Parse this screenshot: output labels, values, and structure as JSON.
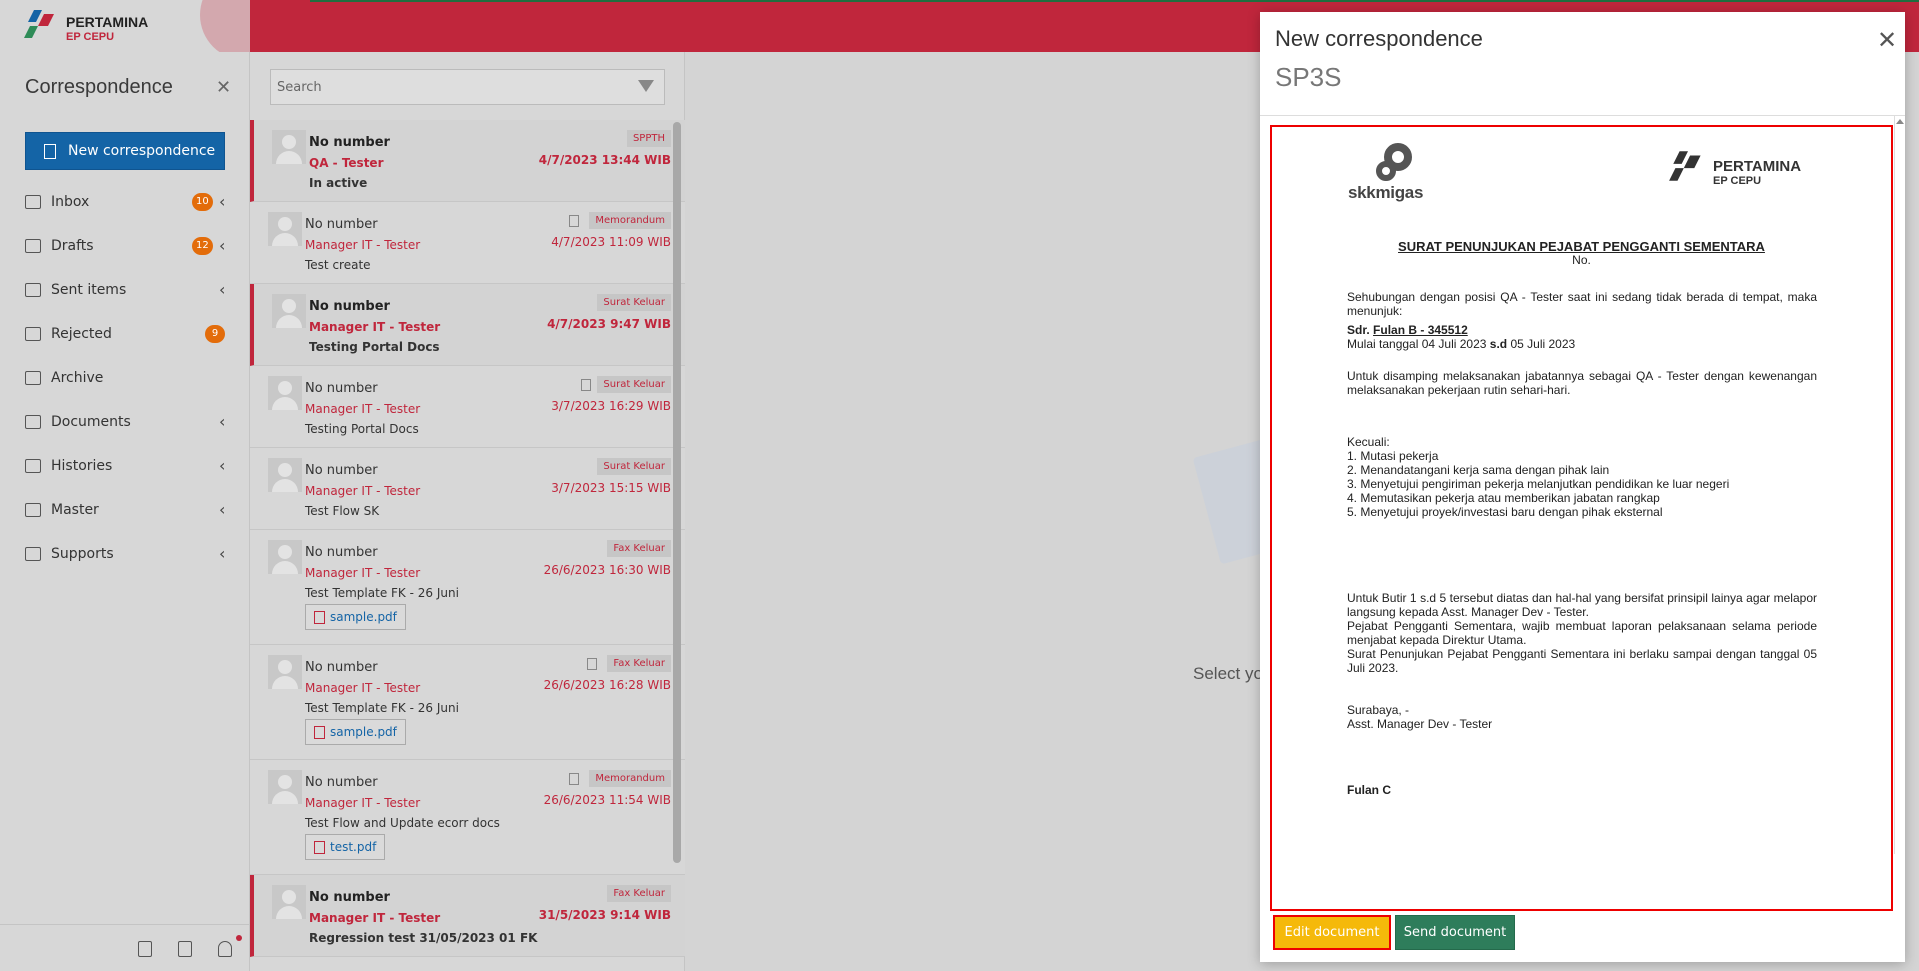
{
  "brand": {
    "name": "PERTAMINA",
    "sub": "EP CEPU"
  },
  "sidebar": {
    "title": "Correspondence",
    "new_button": "New correspondence",
    "items": [
      {
        "label": "Inbox",
        "badge": "10",
        "icon": "inbox-icon"
      },
      {
        "label": "Drafts",
        "badge": "12",
        "icon": "drafts-icon"
      },
      {
        "label": "Sent items",
        "icon": "sent-icon"
      },
      {
        "label": "Rejected",
        "badge": "9",
        "icon": "rejected-icon"
      },
      {
        "label": "Archive",
        "icon": "archive-icon"
      },
      {
        "label": "Documents",
        "icon": "documents-icon"
      },
      {
        "label": "Histories",
        "icon": "histories-icon"
      },
      {
        "label": "Master",
        "icon": "master-icon"
      },
      {
        "label": "Supports",
        "icon": "supports-icon"
      }
    ]
  },
  "search": {
    "placeholder": "Search"
  },
  "messages": [
    {
      "number": "No number",
      "sender": "QA - Tester",
      "subject": "In active",
      "tag": "SPPTH",
      "date": "4/7/2023 13:44 WIB",
      "unread": true
    },
    {
      "number": "No number",
      "sender": "Manager IT - Tester",
      "subject": "Test create",
      "tag": "Memorandum",
      "date": "4/7/2023 11:09 WIB",
      "unread": false
    },
    {
      "number": "No number",
      "sender": "Manager IT - Tester",
      "subject": "Testing Portal Docs",
      "tag": "Surat Keluar",
      "date": "4/7/2023 9:47 WIB",
      "unread": true
    },
    {
      "number": "No number",
      "sender": "Manager IT - Tester",
      "subject": "Testing Portal Docs",
      "tag": "Surat Keluar",
      "date": "3/7/2023 16:29 WIB",
      "unread": false
    },
    {
      "number": "No number",
      "sender": "Manager IT - Tester",
      "subject": "Test Flow SK",
      "tag": "Surat Keluar",
      "date": "3/7/2023 15:15 WIB",
      "unread": false
    },
    {
      "number": "No number",
      "sender": "Manager IT - Tester",
      "subject": "Test Template FK - 26 Juni",
      "tag": "Fax Keluar",
      "date": "26/6/2023 16:30 WIB",
      "attachment": "sample.pdf",
      "unread": false
    },
    {
      "number": "No number",
      "sender": "Manager IT - Tester",
      "subject": "Test Template FK - 26 Juni",
      "tag": "Fax Keluar",
      "date": "26/6/2023 16:28 WIB",
      "attachment": "sample.pdf",
      "unread": false
    },
    {
      "number": "No number",
      "sender": "Manager IT - Tester",
      "subject": "Test Flow and Update ecorr docs",
      "tag": "Memorandum",
      "date": "26/6/2023 11:54 WIB",
      "attachment": "test.pdf",
      "unread": false
    },
    {
      "number": "No number",
      "sender": "Manager IT - Tester",
      "subject": "Regression test 31/05/2023 01 FK",
      "tag": "Fax Keluar",
      "date": "31/5/2023 9:14 WIB",
      "unread": true
    }
  ],
  "center": {
    "placeholder": "Select yo"
  },
  "modal": {
    "title": "New correspondence",
    "subtitle": "SP3S",
    "document": {
      "skk_logo": "skkmigas",
      "pertamina_logo": "PERTAMINA",
      "pertamina_sub": "EP CEPU",
      "title": "SURAT PENUNJUKAN PEJABAT PENGGANTI SEMENTARA",
      "no": "No.",
      "p1": "Sehubungan dengan posisi QA - Tester saat ini sedang tidak berada di tempat, maka menunjuk:",
      "sdr_label": "Sdr.",
      "sdr_name": "Fulan B - 345512",
      "period": "Mulai tanggal 04 Juli 2023",
      "period_sd": "s.d",
      "period_end": "05 Juli 2023",
      "p2": "Untuk disamping melaksanakan jabatannya sebagai QA - Tester dengan kewenangan melaksanakan pekerjaan rutin sehari-hari.",
      "except_title": "Kecuali:",
      "except_items": [
        "1. Mutasi pekerja",
        "2. Menandatangani  kerja sama dengan pihak lain",
        "3. Menyetujui  pengiriman pekerja melanjutkan  pendidikan ke luar negeri",
        "4. Memutasikan pekerja atau memberikan jabatan rangkap",
        "5. Menyetujui  proyek/investasi  baru dengan pihak eksternal"
      ],
      "p3": "Untuk Butir 1 s.d 5 tersebut diatas dan hal-hal yang bersifat prinsipil lainya agar melapor langsung kepada Asst. Manager Dev - Tester.",
      "p4": "Pejabat Pengganti Sementara, wajib membuat laporan pelaksanaan selama periode menjabat kepada Direktur Utama.",
      "p5": "Surat Penunjukan Pejabat Pengganti Sementara ini berlaku sampai dengan tanggal 05 Juli 2023.",
      "place": "Surabaya, -",
      "signer_title": "Asst. Manager Dev - Tester",
      "signer_name": "Fulan C"
    },
    "edit_button": "Edit document",
    "send_button": "Send document"
  },
  "colors": {
    "brand_red": "#c0263c",
    "primary_blue": "#1464a6",
    "edit_yellow": "#f5b90a",
    "send_green": "#2e7d5b",
    "badge_orange": "#e36c0a"
  }
}
